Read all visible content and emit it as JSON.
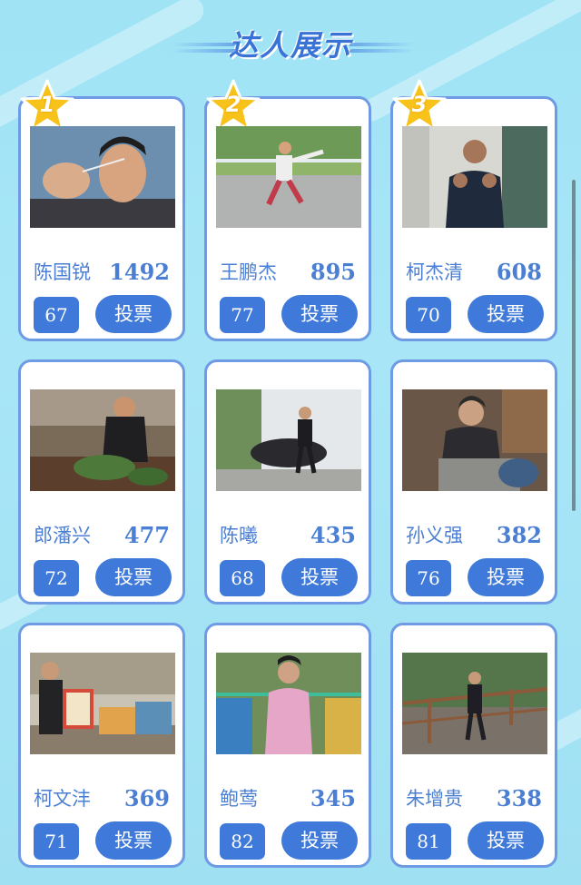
{
  "header": {
    "title": "达人展示"
  },
  "vote_label": "投票",
  "cards": [
    {
      "rank": "1",
      "name": "陈国锐",
      "score": "1492",
      "number": "67"
    },
    {
      "rank": "2",
      "name": "王鹏杰",
      "score": "895",
      "number": "77"
    },
    {
      "rank": "3",
      "name": "柯杰清",
      "score": "608",
      "number": "70"
    },
    {
      "name": "郎潘兴",
      "score": "477",
      "number": "72"
    },
    {
      "name": "陈曦",
      "score": "435",
      "number": "68"
    },
    {
      "name": "孙义强",
      "score": "382",
      "number": "76"
    },
    {
      "name": "柯文沣",
      "score": "369",
      "number": "71"
    },
    {
      "name": "鲍莺",
      "score": "345",
      "number": "82"
    },
    {
      "name": "朱增贵",
      "score": "338",
      "number": "81"
    }
  ],
  "colors": {
    "accent": "#3f79d9",
    "text": "#4b7fd4",
    "card_border": "#6e9be4",
    "star": "#f7c21a",
    "background": "#a8e6f7"
  },
  "icons": {
    "rank_badge": "star-icon"
  }
}
